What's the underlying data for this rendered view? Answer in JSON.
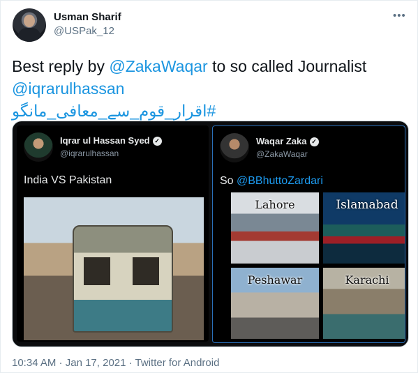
{
  "author": {
    "name": "Usman Sharif",
    "handle": "@USPak_12"
  },
  "more_icon": "more-horizontal-icon",
  "tweet": {
    "line1_prefix": "Best reply by ",
    "line1_mention": "@ZakaWaqar",
    "line1_suffix": " to so called Journalist",
    "line2_mention": "@iqrarulhassan",
    "line3_hashtag": "#اقرار_قوم_سے_معافی_مانگو"
  },
  "media": {
    "left": {
      "name": "Iqrar ul Hassan Syed",
      "handle": "@iqrarulhassan",
      "text": "India VS Pakistan"
    },
    "right": {
      "name": "Waqar Zaka",
      "handle": "@ZakaWaqar",
      "text_prefix": "So ",
      "text_mention": "@BBhuttoZardari",
      "cities": [
        "Lahore",
        "Islamabad",
        "Peshawar",
        "Karachi"
      ]
    }
  },
  "footer": {
    "time": "10:34 AM",
    "sep1": " · ",
    "date": "Jan 17, 2021",
    "sep2": " · ",
    "source": "Twitter for Android"
  },
  "colors": {
    "link": "#1b95e0",
    "muted": "#5b7083"
  }
}
